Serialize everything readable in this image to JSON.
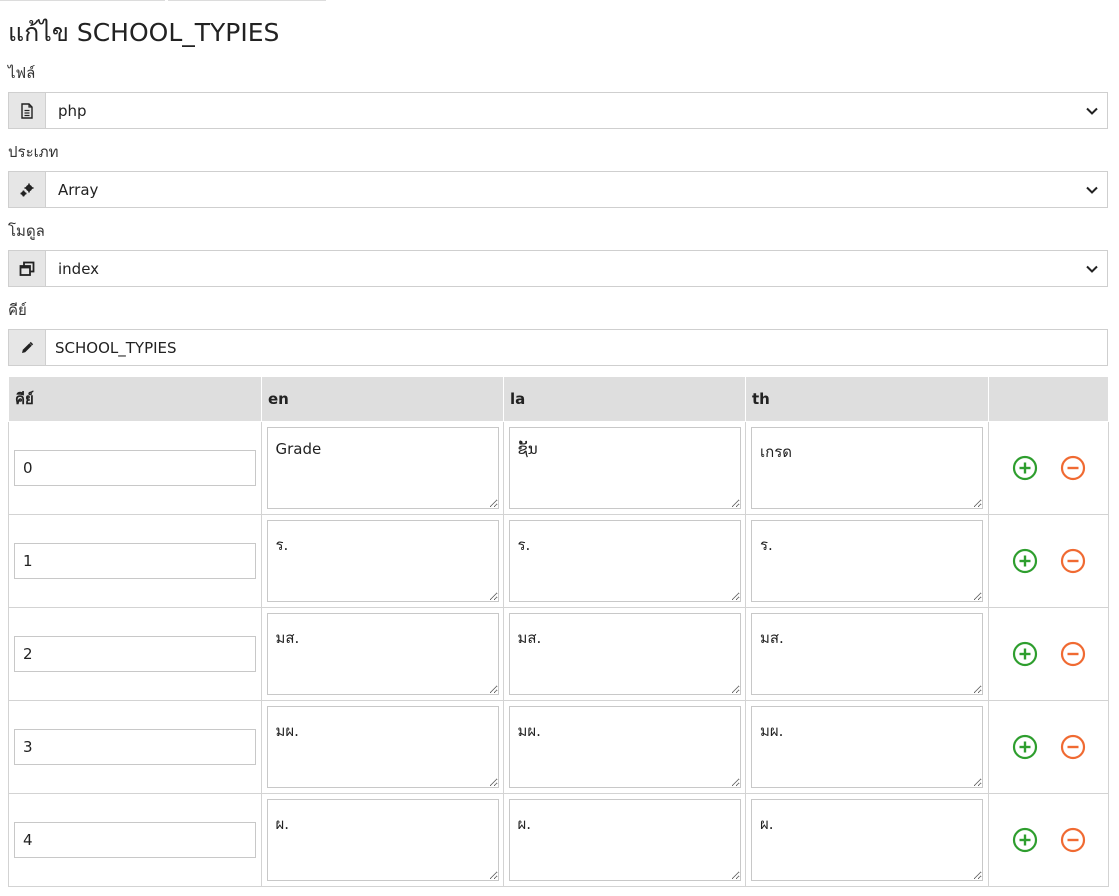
{
  "title": "แก้ไข SCHOOL_TYPIES",
  "fields": {
    "file": {
      "label": "ไฟล์",
      "value": "php",
      "icon": "file-icon"
    },
    "type": {
      "label": "ประเภท",
      "value": "Array",
      "icon": "gears-icon"
    },
    "module": {
      "label": "โมดูล",
      "value": "index",
      "icon": "window-icon"
    },
    "key": {
      "label": "คีย์",
      "value": "SCHOOL_TYPIES",
      "icon": "pencil-icon"
    }
  },
  "table": {
    "headers": [
      "คีย์",
      "en",
      "la",
      "th",
      ""
    ],
    "rows": [
      {
        "key": "0",
        "en": "Grade",
        "la": "ຊັ້ນ",
        "th": "เกรด"
      },
      {
        "key": "1",
        "en": "ร.",
        "la": "ร.",
        "th": "ร."
      },
      {
        "key": "2",
        "en": "มส.",
        "la": "มส.",
        "th": "มส."
      },
      {
        "key": "3",
        "en": "มผ.",
        "la": "มผ.",
        "th": "มผ."
      },
      {
        "key": "4",
        "en": "ผ.",
        "la": "ผ.",
        "th": "ผ."
      }
    ]
  },
  "colors": {
    "add": "#2e9e2e",
    "remove": "#f06a32",
    "header_bg": "#dedede",
    "addon_bg": "#e6e6e6"
  }
}
